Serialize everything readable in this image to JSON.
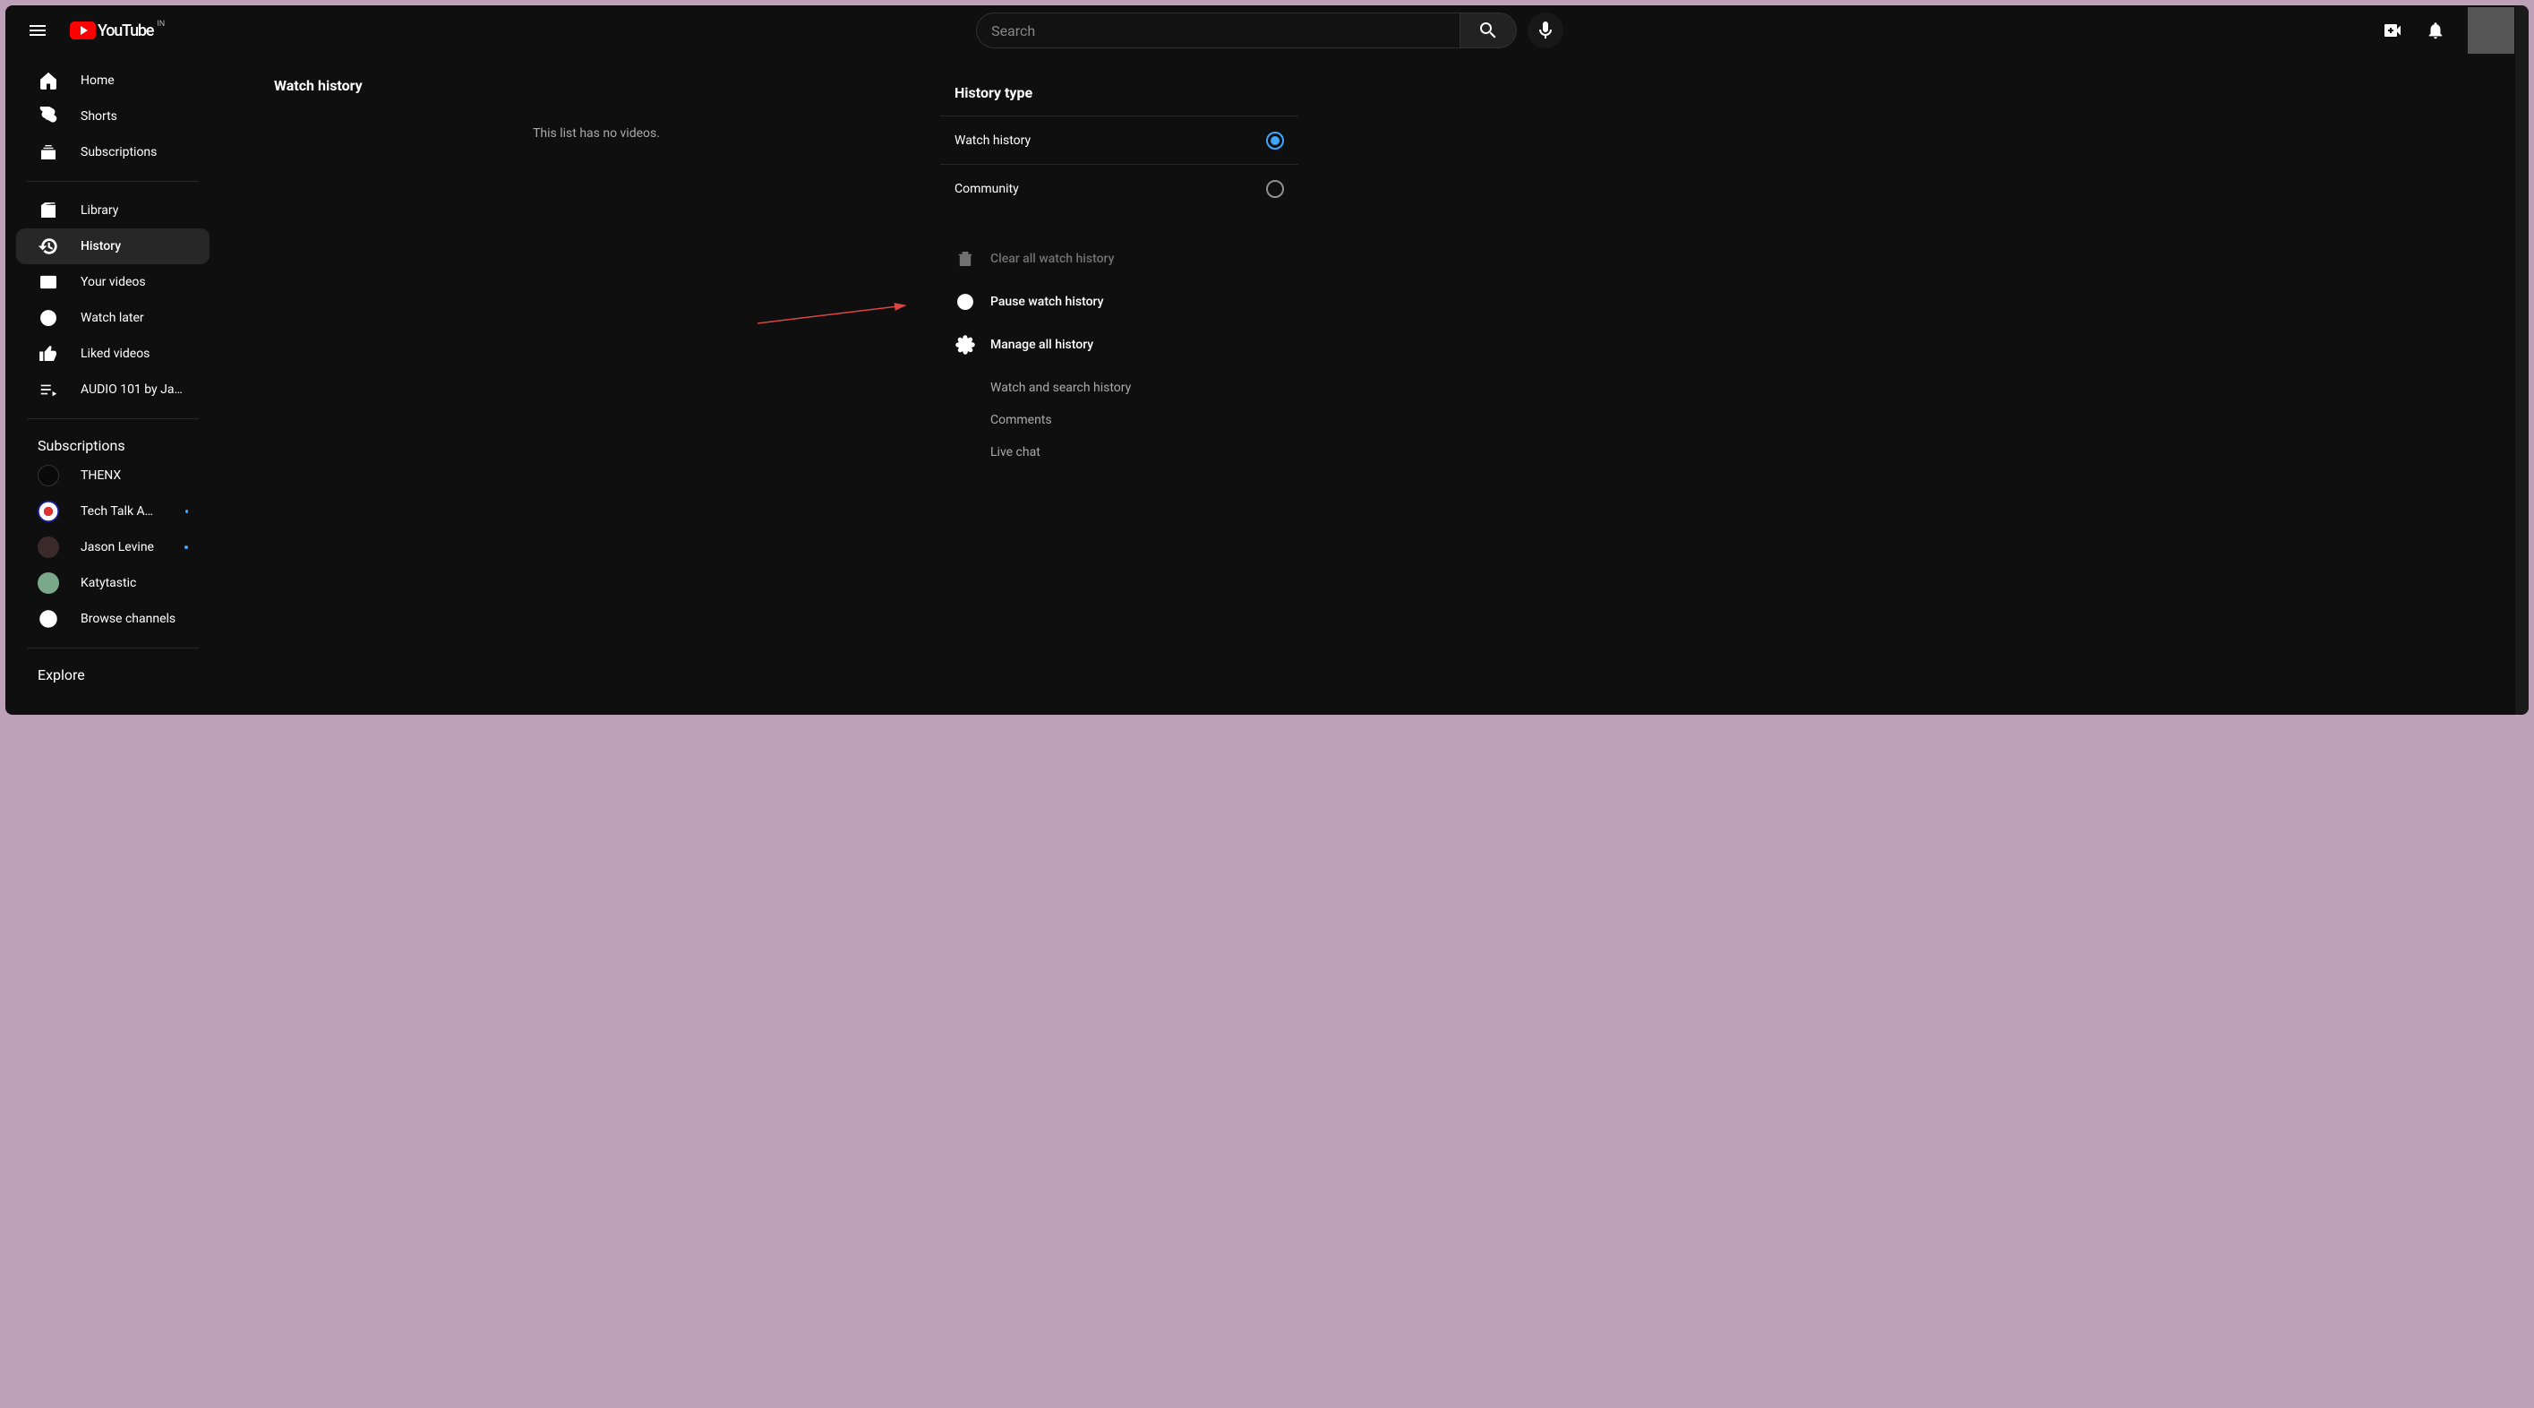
{
  "header": {
    "brand": "YouTube",
    "country_code": "IN",
    "search_placeholder": "Search"
  },
  "sidebar": {
    "primary": [
      {
        "label": "Home"
      },
      {
        "label": "Shorts"
      },
      {
        "label": "Subscriptions"
      }
    ],
    "secondary": [
      {
        "label": "Library"
      },
      {
        "label": "History",
        "active": true
      },
      {
        "label": "Your videos"
      },
      {
        "label": "Watch later"
      },
      {
        "label": "Liked videos"
      },
      {
        "label": "AUDIO 101 by Jaso…"
      }
    ],
    "subs_heading": "Subscriptions",
    "subs": [
      {
        "label": "THENX",
        "dot": false,
        "color": "#0a0a0a"
      },
      {
        "label": "Tech Talk America",
        "dot": true,
        "color": "#e8e8e8"
      },
      {
        "label": "Jason Levine",
        "dot": true,
        "color": "#3b2a2a"
      },
      {
        "label": "Katytastic",
        "dot": false,
        "color": "#7ba88b"
      }
    ],
    "browse_channels": "Browse channels",
    "explore_heading": "Explore"
  },
  "main": {
    "title": "Watch history",
    "empty_message": "This list has no videos."
  },
  "right": {
    "title": "History type",
    "options": [
      {
        "label": "Watch history",
        "checked": true
      },
      {
        "label": "Community",
        "checked": false
      }
    ],
    "actions": {
      "clear": "Clear all watch history",
      "pause": "Pause watch history",
      "manage": "Manage all history"
    },
    "sub_links": [
      "Watch and search history",
      "Comments",
      "Live chat"
    ]
  }
}
